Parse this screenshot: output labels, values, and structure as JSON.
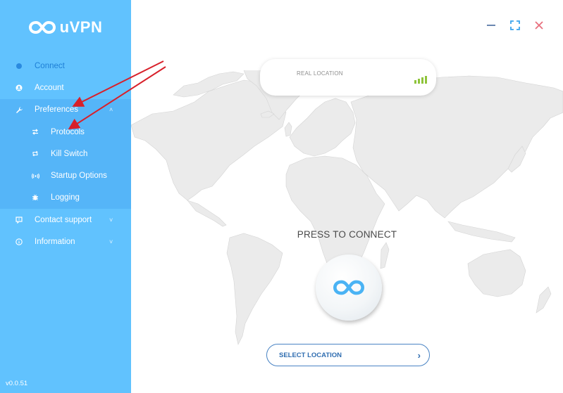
{
  "app": {
    "name": "uVPN",
    "version": "v0.0.51"
  },
  "sidebar": {
    "items": [
      {
        "label": "Connect",
        "icon": "dot-icon",
        "active": true
      },
      {
        "label": "Account",
        "icon": "user-icon"
      },
      {
        "label": "Preferences",
        "icon": "wrench-icon",
        "expanded": true,
        "chevron": "˄"
      },
      {
        "label": "Protocols",
        "icon": "swap-arrows-icon",
        "sub": true
      },
      {
        "label": "Kill Switch",
        "icon": "cycle-arrows-icon",
        "sub": true
      },
      {
        "label": "Startup Options",
        "icon": "broadcast-icon",
        "sub": true
      },
      {
        "label": "Logging",
        "icon": "bug-icon",
        "sub": true
      },
      {
        "label": "Contact support",
        "icon": "chat-icon",
        "chevron": "˅"
      },
      {
        "label": "Information",
        "icon": "info-icon",
        "chevron": "˅"
      }
    ]
  },
  "window": {
    "minimize": "minimize-icon",
    "maximize": "maximize-icon",
    "close": "close-icon"
  },
  "location_card": {
    "label": "REAL LOCATION",
    "signal_icon": "signal-strength-icon",
    "signal_bars": 4
  },
  "main": {
    "press_label": "PRESS TO CONNECT",
    "select_location": "SELECT LOCATION",
    "select_chevron": "›"
  },
  "colors": {
    "sidebar_bg": "#61c2fe",
    "sidebar_expanded_bg": "#55b5f8",
    "accent_blue": "#4ab3f4",
    "active_text": "#1e7fd6",
    "close_red": "#e8707e",
    "signal_green": "#8fc43b",
    "annotation_red": "#d8202a"
  }
}
